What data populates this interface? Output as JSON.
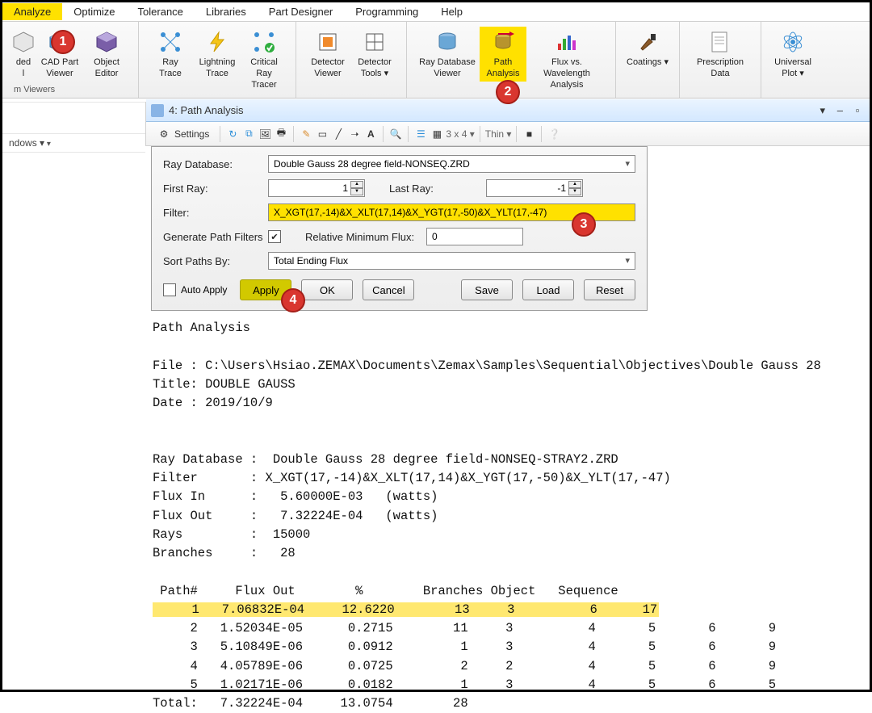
{
  "menubar": {
    "items": [
      "Analyze",
      "Optimize",
      "Tolerance",
      "Libraries",
      "Part Designer",
      "Programming",
      "Help"
    ],
    "active_index": 0
  },
  "ribbon": {
    "left_group_label": "m Viewers",
    "buttons": [
      {
        "label_line1": "ded",
        "label_line2": "l"
      },
      {
        "label_line1": "CAD Part",
        "label_line2": "Viewer"
      },
      {
        "label_line1": "Object",
        "label_line2": "Editor"
      },
      {
        "label_line1": "Ray",
        "label_line2": "Trace"
      },
      {
        "label_line1": "Lightning",
        "label_line2": "Trace"
      },
      {
        "label_line1": "Critical Ray",
        "label_line2": "Tracer"
      },
      {
        "label_line1": "Detector",
        "label_line2": "Viewer"
      },
      {
        "label_line1": "Detector",
        "label_line2": "Tools ▾"
      },
      {
        "label_line1": "Ray Database",
        "label_line2": "Viewer"
      },
      {
        "label_line1": "Path",
        "label_line2": "Analysis"
      },
      {
        "label_line1": "Flux vs.",
        "label_line2": "Wavelength Analysis"
      },
      {
        "label_line1": "Coatings ▾",
        "label_line2": ""
      },
      {
        "label_line1": "Prescription",
        "label_line2": "Data"
      },
      {
        "label_line1": "Universal",
        "label_line2": "Plot ▾"
      }
    ]
  },
  "sidepanel": {
    "item1": "ndows ▾",
    "item2": ""
  },
  "window": {
    "title": "4: Path Analysis"
  },
  "toolbar": {
    "settings_label": "Settings",
    "grid_label": "3 x 4 ▾",
    "thin_label": "Thin ▾"
  },
  "settings": {
    "ray_db_label": "Ray Database:",
    "ray_db_value": "Double Gauss 28 degree field-NONSEQ.ZRD",
    "first_ray_label": "First Ray:",
    "first_ray_value": "1",
    "last_ray_label": "Last Ray:",
    "last_ray_value": "-1",
    "filter_label": "Filter:",
    "filter_value": "X_XGT(17,-14)&X_XLT(17,14)&X_YGT(17,-50)&X_YLT(17,-47)",
    "gen_filters_label": "Generate Path Filters",
    "rel_min_flux_label": "Relative Minimum Flux:",
    "rel_min_flux_value": "0",
    "sort_label": "Sort Paths By:",
    "sort_value": "Total Ending Flux",
    "auto_apply_label": "Auto Apply",
    "apply_label": "Apply",
    "ok_label": "OK",
    "cancel_label": "Cancel",
    "save_label": "Save",
    "load_label": "Load",
    "reset_label": "Reset"
  },
  "output": {
    "title": "Path Analysis",
    "file_label": "File : ",
    "file_value": "C:\\Users\\Hsiao.ZEMAX\\Documents\\Zemax\\Samples\\Sequential\\Objectives\\Double Gauss 28",
    "title_label": "Title: ",
    "title_value": "DOUBLE GAUSS",
    "date_label": "Date : ",
    "date_value": "2019/10/9",
    "ray_db_label": "Ray Database :  ",
    "ray_db_value": "Double Gauss 28 degree field-NONSEQ-STRAY2.ZRD",
    "filter_label": "Filter       : ",
    "filter_value": "X_XGT(17,-14)&X_XLT(17,14)&X_YGT(17,-50)&X_YLT(17,-47)",
    "flux_in_label": "Flux In      :   ",
    "flux_in_value": "5.60000E-03",
    "flux_in_unit": "   (watts)",
    "flux_out_label": "Flux Out     :   ",
    "flux_out_value": "7.32224E-04",
    "flux_out_unit": "   (watts)",
    "rays_label": "Rays         :  ",
    "rays_value": "15000",
    "branches_label": "Branches     :   ",
    "branches_value": "28",
    "header": " Path#     Flux Out        %        Branches Object   Sequence",
    "rows": [
      {
        "path": 1,
        "flux": "7.06832E-04",
        "pct": "12.6220",
        "branches": 13,
        "obj": 3,
        "seq": [
          6,
          17
        ]
      },
      {
        "path": 2,
        "flux": "1.52034E-05",
        "pct": " 0.2715",
        "branches": 11,
        "obj": 3,
        "seq": [
          4,
          5,
          6,
          9
        ]
      },
      {
        "path": 3,
        "flux": "5.10849E-06",
        "pct": " 0.0912",
        "branches": 1,
        "obj": 3,
        "seq": [
          4,
          5,
          6,
          9
        ]
      },
      {
        "path": 4,
        "flux": "4.05789E-06",
        "pct": " 0.0725",
        "branches": 2,
        "obj": 2,
        "seq": [
          4,
          5,
          6,
          9
        ]
      },
      {
        "path": 5,
        "flux": "1.02171E-06",
        "pct": " 0.0182",
        "branches": 1,
        "obj": 3,
        "seq": [
          4,
          5,
          6,
          5
        ]
      }
    ],
    "total_label": "Total:",
    "total_flux": "7.32224E-04",
    "total_pct": "13.0754",
    "total_branches": "28"
  },
  "callouts": {
    "c1": "1",
    "c2": "2",
    "c3": "3",
    "c4": "4"
  }
}
